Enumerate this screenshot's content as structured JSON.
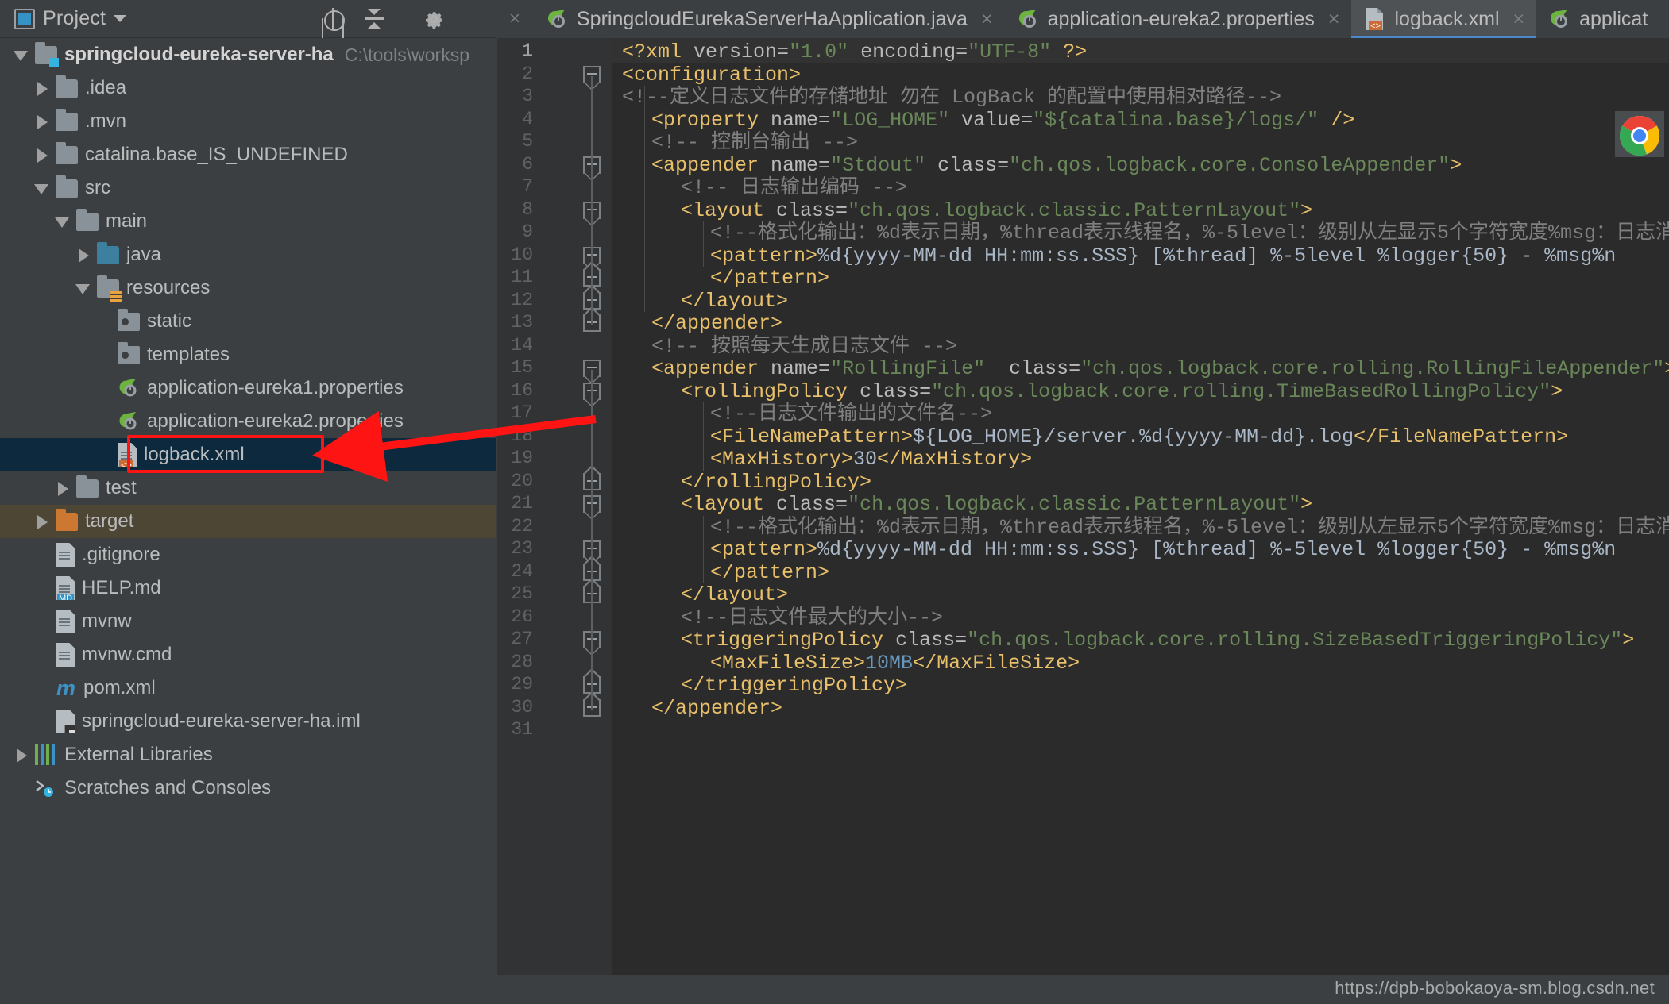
{
  "window": {
    "theme_bg": "#3c3f41",
    "editor_bg": "#2b2b2b",
    "accent": "#3592c4",
    "annotation_color": "#ff1414"
  },
  "project_panel": {
    "title": "Project",
    "icons": {
      "project": "project-icon",
      "caret": "chevron-down-icon",
      "locate": "locate-target-icon",
      "collapse_all": "collapse-all-icon",
      "settings": "gear-icon",
      "hide": "minimize-icon"
    },
    "tree": [
      {
        "label": "springcloud-eureka-server-ha",
        "path": "C:\\tools\\worksp",
        "depth": 0,
        "arrow": "open",
        "icon": "module-folder",
        "bold": true,
        "state": "normal"
      },
      {
        "label": ".idea",
        "path": "",
        "depth": 1,
        "arrow": "closed",
        "icon": "folder",
        "bold": false,
        "state": "normal"
      },
      {
        "label": ".mvn",
        "path": "",
        "depth": 1,
        "arrow": "closed",
        "icon": "folder",
        "bold": false,
        "state": "normal"
      },
      {
        "label": "catalina.base_IS_UNDEFINED",
        "path": "",
        "depth": 1,
        "arrow": "closed",
        "icon": "folder",
        "bold": false,
        "state": "normal"
      },
      {
        "label": "src",
        "path": "",
        "depth": 1,
        "arrow": "open",
        "icon": "folder",
        "bold": false,
        "state": "normal"
      },
      {
        "label": "main",
        "path": "",
        "depth": 2,
        "arrow": "open",
        "icon": "folder",
        "bold": false,
        "state": "normal"
      },
      {
        "label": "java",
        "path": "",
        "depth": 3,
        "arrow": "closed",
        "icon": "folder-source",
        "bold": false,
        "state": "normal"
      },
      {
        "label": "resources",
        "path": "",
        "depth": 3,
        "arrow": "open",
        "icon": "folder-resources",
        "bold": false,
        "state": "normal"
      },
      {
        "label": "static",
        "path": "",
        "depth": 4,
        "arrow": "none",
        "icon": "package-folder",
        "bold": false,
        "state": "normal"
      },
      {
        "label": "templates",
        "path": "",
        "depth": 4,
        "arrow": "none",
        "icon": "package-folder",
        "bold": false,
        "state": "normal"
      },
      {
        "label": "application-eureka1.properties",
        "path": "",
        "depth": 4,
        "arrow": "none",
        "icon": "spring-properties",
        "bold": false,
        "state": "normal"
      },
      {
        "label": "application-eureka2.properties",
        "path": "",
        "depth": 4,
        "arrow": "none",
        "icon": "spring-properties",
        "bold": false,
        "state": "normal"
      },
      {
        "label": "logback.xml",
        "path": "",
        "depth": 4,
        "arrow": "none",
        "icon": "xml-file",
        "bold": false,
        "state": "selected"
      },
      {
        "label": "test",
        "path": "",
        "depth": 2,
        "arrow": "closed",
        "icon": "folder",
        "bold": false,
        "state": "normal"
      },
      {
        "label": "target",
        "path": "",
        "depth": 1,
        "arrow": "closed",
        "icon": "folder-excluded",
        "bold": false,
        "state": "highlighted"
      },
      {
        "label": ".gitignore",
        "path": "",
        "depth": 1,
        "arrow": "none",
        "icon": "text-file",
        "bold": false,
        "state": "normal"
      },
      {
        "label": "HELP.md",
        "path": "",
        "depth": 1,
        "arrow": "none",
        "icon": "markdown-file",
        "bold": false,
        "state": "normal"
      },
      {
        "label": "mvnw",
        "path": "",
        "depth": 1,
        "arrow": "none",
        "icon": "text-file",
        "bold": false,
        "state": "normal"
      },
      {
        "label": "mvnw.cmd",
        "path": "",
        "depth": 1,
        "arrow": "none",
        "icon": "text-file",
        "bold": false,
        "state": "normal"
      },
      {
        "label": "pom.xml",
        "path": "",
        "depth": 1,
        "arrow": "none",
        "icon": "maven-file",
        "bold": false,
        "state": "normal"
      },
      {
        "label": "springcloud-eureka-server-ha.iml",
        "path": "",
        "depth": 1,
        "arrow": "none",
        "icon": "iml-file",
        "bold": false,
        "state": "normal"
      },
      {
        "label": "External Libraries",
        "path": "",
        "depth": 0,
        "arrow": "closed",
        "icon": "library-icon",
        "bold": false,
        "state": "normal"
      },
      {
        "label": "Scratches and Consoles",
        "path": "",
        "depth": 0,
        "arrow": "none",
        "icon": "scratches-icon",
        "bold": false,
        "state": "normal"
      }
    ]
  },
  "editor_tabs": [
    {
      "label": "SpringcloudEurekaServerHaApplication.java",
      "icon": "spring-boot-icon",
      "active": false,
      "closable": true
    },
    {
      "label": "application-eureka2.properties",
      "icon": "spring-properties-icon",
      "active": false,
      "closable": true
    },
    {
      "label": "logback.xml",
      "icon": "xml-file-icon",
      "active": true,
      "closable": true
    },
    {
      "label": "applicat",
      "icon": "spring-properties-icon",
      "active": false,
      "closable": false
    }
  ],
  "code": {
    "file": "logback.xml",
    "first_line": 1,
    "last_line": 31,
    "lines": [
      {
        "n": 1,
        "indent": 0,
        "html": "<span class='tg'>&lt;?xml</span> <span class='at'>version=</span><span class='st'>\"1.0\"</span> <span class='at'>encoding=</span><span class='st'>\"UTF-8\"</span> <span class='tg'>?&gt;</span>"
      },
      {
        "n": 2,
        "indent": 0,
        "html": "<span class='tg'>&lt;configuration&gt;</span>"
      },
      {
        "n": 3,
        "indent": 0,
        "html": "<span class='cm'>&lt;!--定义日志文件的存储地址 勿在 LogBack 的配置中使用相对路径--&gt;</span>"
      },
      {
        "n": 4,
        "indent": 1,
        "html": "<span class='tg'>&lt;property</span> <span class='at'>name=</span><span class='st'>\"LOG_HOME\"</span> <span class='at'>value=</span><span class='st'>\"${catalina.base}/logs/\"</span> <span class='tg'>/&gt;</span>"
      },
      {
        "n": 5,
        "indent": 1,
        "html": "<span class='cm'>&lt;!-- 控制台输出 --&gt;</span>"
      },
      {
        "n": 6,
        "indent": 1,
        "html": "<span class='tg'>&lt;appender</span> <span class='at'>name=</span><span class='st'>\"Stdout\"</span> <span class='at'>class=</span><span class='st'>\"ch.qos.logback.core.ConsoleAppender\"</span><span class='tg'>&gt;</span>"
      },
      {
        "n": 7,
        "indent": 2,
        "html": "<span class='cm'>&lt;!-- 日志输出编码 --&gt;</span>"
      },
      {
        "n": 8,
        "indent": 2,
        "html": "<span class='tg'>&lt;layout</span> <span class='at'>class=</span><span class='st'>\"ch.qos.logback.classic.PatternLayout\"</span><span class='tg'>&gt;</span>"
      },
      {
        "n": 9,
        "indent": 3,
        "html": "<span class='cm'>&lt;!--格式化输出：%d表示日期，%thread表示线程名，%-5level：级别从左显示5个字符宽度%msg：日志消息，%n是</span>"
      },
      {
        "n": 10,
        "indent": 3,
        "html": "<span class='tg'>&lt;pattern&gt;</span><span class='tx'>%d{yyyy-MM-dd HH:mm:ss.SSS} [%thread] %-5level %logger{50} - %msg%n</span>"
      },
      {
        "n": 11,
        "indent": 3,
        "html": "<span class='tg'>&lt;/pattern&gt;</span>"
      },
      {
        "n": 12,
        "indent": 2,
        "html": "<span class='tg'>&lt;/layout&gt;</span>"
      },
      {
        "n": 13,
        "indent": 1,
        "html": "<span class='tg'>&lt;/appender&gt;</span>"
      },
      {
        "n": 14,
        "indent": 1,
        "html": "<span class='cm'>&lt;!-- 按照每天生成日志文件 --&gt;</span>"
      },
      {
        "n": 15,
        "indent": 1,
        "html": "<span class='tg'>&lt;appender</span> <span class='at'>name=</span><span class='st'>\"RollingFile\"</span>  <span class='at'>class=</span><span class='st'>\"ch.qos.logback.core.rolling.RollingFileAppender\"</span><span class='tg'>&gt;</span>"
      },
      {
        "n": 16,
        "indent": 2,
        "html": "<span class='tg'>&lt;rollingPolicy</span> <span class='at'>class=</span><span class='st'>\"ch.qos.logback.core.rolling.TimeBasedRollingPolicy\"</span><span class='tg'>&gt;</span>"
      },
      {
        "n": 17,
        "indent": 3,
        "html": "<span class='cm'>&lt;!--日志文件输出的文件名--&gt;</span>"
      },
      {
        "n": 18,
        "indent": 3,
        "html": "<span class='tg'>&lt;FileNamePattern&gt;</span><span class='tx'>${LOG_HOME}/server.%d{yyyy-MM-dd}.log</span><span class='tg'>&lt;/FileNamePattern&gt;</span>"
      },
      {
        "n": 19,
        "indent": 3,
        "html": "<span class='tg'>&lt;MaxHistory&gt;</span><span class='tx'>30</span><span class='tg'>&lt;/MaxHistory&gt;</span>"
      },
      {
        "n": 20,
        "indent": 2,
        "html": "<span class='tg'>&lt;/rollingPolicy&gt;</span>"
      },
      {
        "n": 21,
        "indent": 2,
        "html": "<span class='tg'>&lt;layout</span> <span class='at'>class=</span><span class='st'>\"ch.qos.logback.classic.PatternLayout\"</span><span class='tg'>&gt;</span>"
      },
      {
        "n": 22,
        "indent": 3,
        "html": "<span class='cm'>&lt;!--格式化输出：%d表示日期，%thread表示线程名，%-5level：级别从左显示5个字符宽度%msg：日志消息，%n是</span>"
      },
      {
        "n": 23,
        "indent": 3,
        "html": "<span class='tg'>&lt;pattern&gt;</span><span class='tx'>%d{yyyy-MM-dd HH:mm:ss.SSS} [%thread] %-5level %logger{50} - %msg%n</span>"
      },
      {
        "n": 24,
        "indent": 3,
        "html": "<span class='tg'>&lt;/pattern&gt;</span>"
      },
      {
        "n": 25,
        "indent": 2,
        "html": "<span class='tg'>&lt;/layout&gt;</span>"
      },
      {
        "n": 26,
        "indent": 2,
        "html": "<span class='cm'>&lt;!--日志文件最大的大小--&gt;</span>"
      },
      {
        "n": 27,
        "indent": 2,
        "html": "<span class='tg'>&lt;triggeringPolicy</span> <span class='at'>class=</span><span class='st'>\"ch.qos.logback.core.rolling.SizeBasedTriggeringPolicy\"</span><span class='tg'>&gt;</span>"
      },
      {
        "n": 28,
        "indent": 3,
        "html": "<span class='tg'>&lt;MaxFileSize&gt;</span><span class='nmv'>10MB</span><span class='tg'>&lt;/MaxFileSize&gt;</span>"
      },
      {
        "n": 29,
        "indent": 2,
        "html": "<span class='tg'>&lt;/triggeringPolicy&gt;</span>"
      },
      {
        "n": 30,
        "indent": 1,
        "html": "<span class='tg'>&lt;/appender&gt;</span>"
      },
      {
        "n": 31,
        "indent": 0,
        "html": ""
      }
    ]
  },
  "annotations": {
    "highlight_target": "logback.xml",
    "arrow_color": "#ff1414"
  },
  "status": {
    "watermark": "https://dpb-bobokaoya-sm.blog.csdn.net"
  }
}
